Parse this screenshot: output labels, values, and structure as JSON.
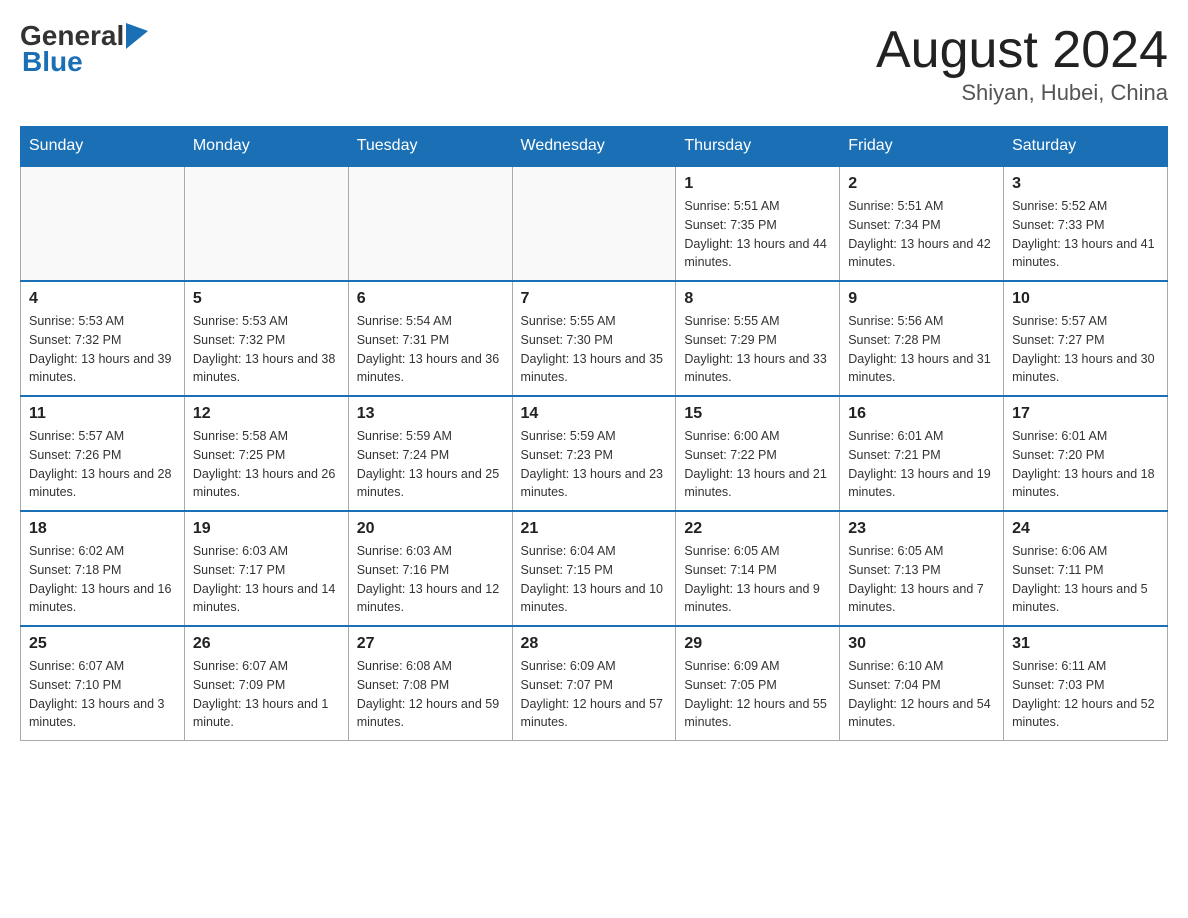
{
  "header": {
    "logo_general": "General",
    "logo_blue": "Blue",
    "month_title": "August 2024",
    "location": "Shiyan, Hubei, China"
  },
  "days_of_week": [
    "Sunday",
    "Monday",
    "Tuesday",
    "Wednesday",
    "Thursday",
    "Friday",
    "Saturday"
  ],
  "weeks": [
    {
      "days": [
        {
          "num": "",
          "info": ""
        },
        {
          "num": "",
          "info": ""
        },
        {
          "num": "",
          "info": ""
        },
        {
          "num": "",
          "info": ""
        },
        {
          "num": "1",
          "info": "Sunrise: 5:51 AM\nSunset: 7:35 PM\nDaylight: 13 hours and 44 minutes."
        },
        {
          "num": "2",
          "info": "Sunrise: 5:51 AM\nSunset: 7:34 PM\nDaylight: 13 hours and 42 minutes."
        },
        {
          "num": "3",
          "info": "Sunrise: 5:52 AM\nSunset: 7:33 PM\nDaylight: 13 hours and 41 minutes."
        }
      ]
    },
    {
      "days": [
        {
          "num": "4",
          "info": "Sunrise: 5:53 AM\nSunset: 7:32 PM\nDaylight: 13 hours and 39 minutes."
        },
        {
          "num": "5",
          "info": "Sunrise: 5:53 AM\nSunset: 7:32 PM\nDaylight: 13 hours and 38 minutes."
        },
        {
          "num": "6",
          "info": "Sunrise: 5:54 AM\nSunset: 7:31 PM\nDaylight: 13 hours and 36 minutes."
        },
        {
          "num": "7",
          "info": "Sunrise: 5:55 AM\nSunset: 7:30 PM\nDaylight: 13 hours and 35 minutes."
        },
        {
          "num": "8",
          "info": "Sunrise: 5:55 AM\nSunset: 7:29 PM\nDaylight: 13 hours and 33 minutes."
        },
        {
          "num": "9",
          "info": "Sunrise: 5:56 AM\nSunset: 7:28 PM\nDaylight: 13 hours and 31 minutes."
        },
        {
          "num": "10",
          "info": "Sunrise: 5:57 AM\nSunset: 7:27 PM\nDaylight: 13 hours and 30 minutes."
        }
      ]
    },
    {
      "days": [
        {
          "num": "11",
          "info": "Sunrise: 5:57 AM\nSunset: 7:26 PM\nDaylight: 13 hours and 28 minutes."
        },
        {
          "num": "12",
          "info": "Sunrise: 5:58 AM\nSunset: 7:25 PM\nDaylight: 13 hours and 26 minutes."
        },
        {
          "num": "13",
          "info": "Sunrise: 5:59 AM\nSunset: 7:24 PM\nDaylight: 13 hours and 25 minutes."
        },
        {
          "num": "14",
          "info": "Sunrise: 5:59 AM\nSunset: 7:23 PM\nDaylight: 13 hours and 23 minutes."
        },
        {
          "num": "15",
          "info": "Sunrise: 6:00 AM\nSunset: 7:22 PM\nDaylight: 13 hours and 21 minutes."
        },
        {
          "num": "16",
          "info": "Sunrise: 6:01 AM\nSunset: 7:21 PM\nDaylight: 13 hours and 19 minutes."
        },
        {
          "num": "17",
          "info": "Sunrise: 6:01 AM\nSunset: 7:20 PM\nDaylight: 13 hours and 18 minutes."
        }
      ]
    },
    {
      "days": [
        {
          "num": "18",
          "info": "Sunrise: 6:02 AM\nSunset: 7:18 PM\nDaylight: 13 hours and 16 minutes."
        },
        {
          "num": "19",
          "info": "Sunrise: 6:03 AM\nSunset: 7:17 PM\nDaylight: 13 hours and 14 minutes."
        },
        {
          "num": "20",
          "info": "Sunrise: 6:03 AM\nSunset: 7:16 PM\nDaylight: 13 hours and 12 minutes."
        },
        {
          "num": "21",
          "info": "Sunrise: 6:04 AM\nSunset: 7:15 PM\nDaylight: 13 hours and 10 minutes."
        },
        {
          "num": "22",
          "info": "Sunrise: 6:05 AM\nSunset: 7:14 PM\nDaylight: 13 hours and 9 minutes."
        },
        {
          "num": "23",
          "info": "Sunrise: 6:05 AM\nSunset: 7:13 PM\nDaylight: 13 hours and 7 minutes."
        },
        {
          "num": "24",
          "info": "Sunrise: 6:06 AM\nSunset: 7:11 PM\nDaylight: 13 hours and 5 minutes."
        }
      ]
    },
    {
      "days": [
        {
          "num": "25",
          "info": "Sunrise: 6:07 AM\nSunset: 7:10 PM\nDaylight: 13 hours and 3 minutes."
        },
        {
          "num": "26",
          "info": "Sunrise: 6:07 AM\nSunset: 7:09 PM\nDaylight: 13 hours and 1 minute."
        },
        {
          "num": "27",
          "info": "Sunrise: 6:08 AM\nSunset: 7:08 PM\nDaylight: 12 hours and 59 minutes."
        },
        {
          "num": "28",
          "info": "Sunrise: 6:09 AM\nSunset: 7:07 PM\nDaylight: 12 hours and 57 minutes."
        },
        {
          "num": "29",
          "info": "Sunrise: 6:09 AM\nSunset: 7:05 PM\nDaylight: 12 hours and 55 minutes."
        },
        {
          "num": "30",
          "info": "Sunrise: 6:10 AM\nSunset: 7:04 PM\nDaylight: 12 hours and 54 minutes."
        },
        {
          "num": "31",
          "info": "Sunrise: 6:11 AM\nSunset: 7:03 PM\nDaylight: 12 hours and 52 minutes."
        }
      ]
    }
  ]
}
